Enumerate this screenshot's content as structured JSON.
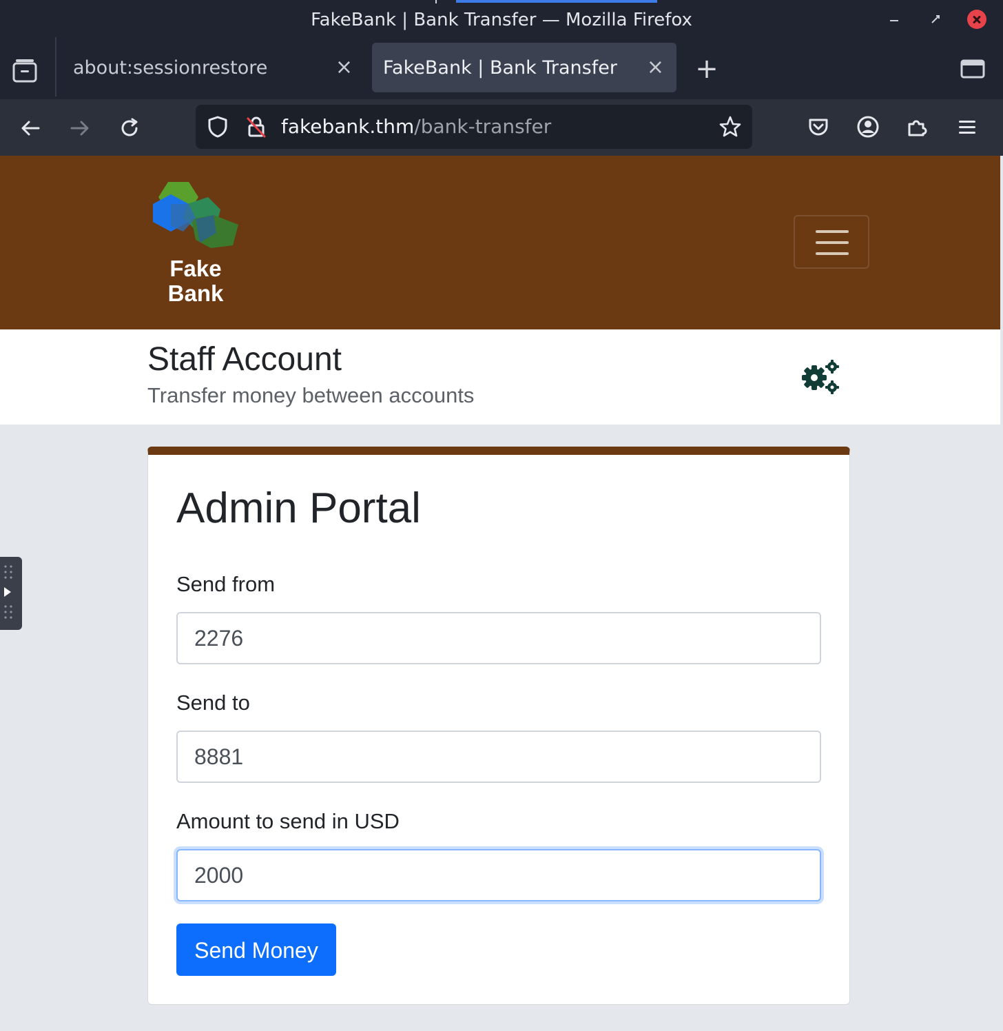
{
  "window": {
    "title": "FakeBank | Bank Transfer — Mozilla Firefox"
  },
  "tabs": [
    {
      "label": "about:sessionrestore",
      "active": false
    },
    {
      "label": "FakeBank | Bank Transfer",
      "active": true
    }
  ],
  "address_bar": {
    "host": "fakebank.thm",
    "path": "/bank-transfer"
  },
  "icons": {
    "back": "arrow-left-icon",
    "forward": "arrow-right-icon",
    "reload": "reload-icon",
    "shield": "tracking-protection-icon",
    "lock": "insecure-lock-icon",
    "bookmark": "star-icon",
    "pocket": "pocket-icon",
    "account": "account-icon",
    "extensions": "extensions-icon",
    "menu": "hamburger-menu-icon"
  },
  "site": {
    "logo_line1": "Fake",
    "logo_line2": "Bank",
    "header_color": "#6b3a13",
    "page_title": "Staff Account",
    "page_subtitle": "Transfer money between accounts"
  },
  "form": {
    "title": "Admin Portal",
    "from_label": "Send from",
    "from_value": "2276",
    "to_label": "Send to",
    "to_value": "8881",
    "amount_label": "Amount to send in USD",
    "amount_value": "2000",
    "submit_label": "Send Money",
    "accent_color": "#0d6efd"
  }
}
